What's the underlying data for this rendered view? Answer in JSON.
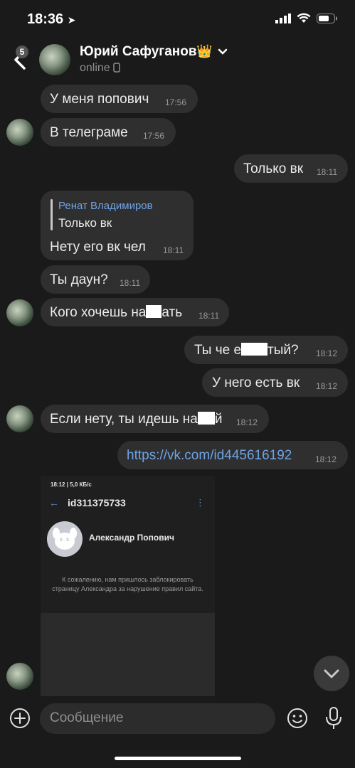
{
  "status_bar": {
    "time": "18:36"
  },
  "header": {
    "back_badge": "5",
    "name": "Юрий Сафуганов",
    "status": "online"
  },
  "messages": [
    {
      "text": "У меня попович",
      "time": "17:56"
    },
    {
      "text": "В телеграме",
      "time": "17:56"
    },
    {
      "text": "Только вк",
      "time": "18:11"
    },
    {
      "reply_author": "Ренат Владимиров",
      "reply_text": "Только вк",
      "text": "Нету его вк чел",
      "time": "18:11"
    },
    {
      "text": "Ты даун?",
      "time": "18:11"
    },
    {
      "text_a": "Кого хочешь на",
      "text_b": "ать",
      "time": "18:11"
    },
    {
      "text_a": "Ты че е",
      "text_b": "тый?",
      "time": "18:12"
    },
    {
      "text": "У него есть вк",
      "time": "18:12"
    },
    {
      "text_a": "Если нету, ты идешь на",
      "text_b": "й",
      "time": "18:12"
    },
    {
      "text": "https://vk.com/id445616192",
      "time": "18:12"
    }
  ],
  "attached_screenshot": {
    "status": "18:12 | 5,0 КБ/с",
    "page_id": "id311375733",
    "user_name": "Александр Попович",
    "blocked_message": "К сожалению, нам пришлось заблокировать страницу Александра за нарушение правил сайта."
  },
  "composer": {
    "placeholder": "Сообщение"
  },
  "colors": {
    "background": "#1a1a1a",
    "bubble": "#2f2f2f",
    "link": "#6ea3e6",
    "reply_author": "#6ea3e6"
  }
}
